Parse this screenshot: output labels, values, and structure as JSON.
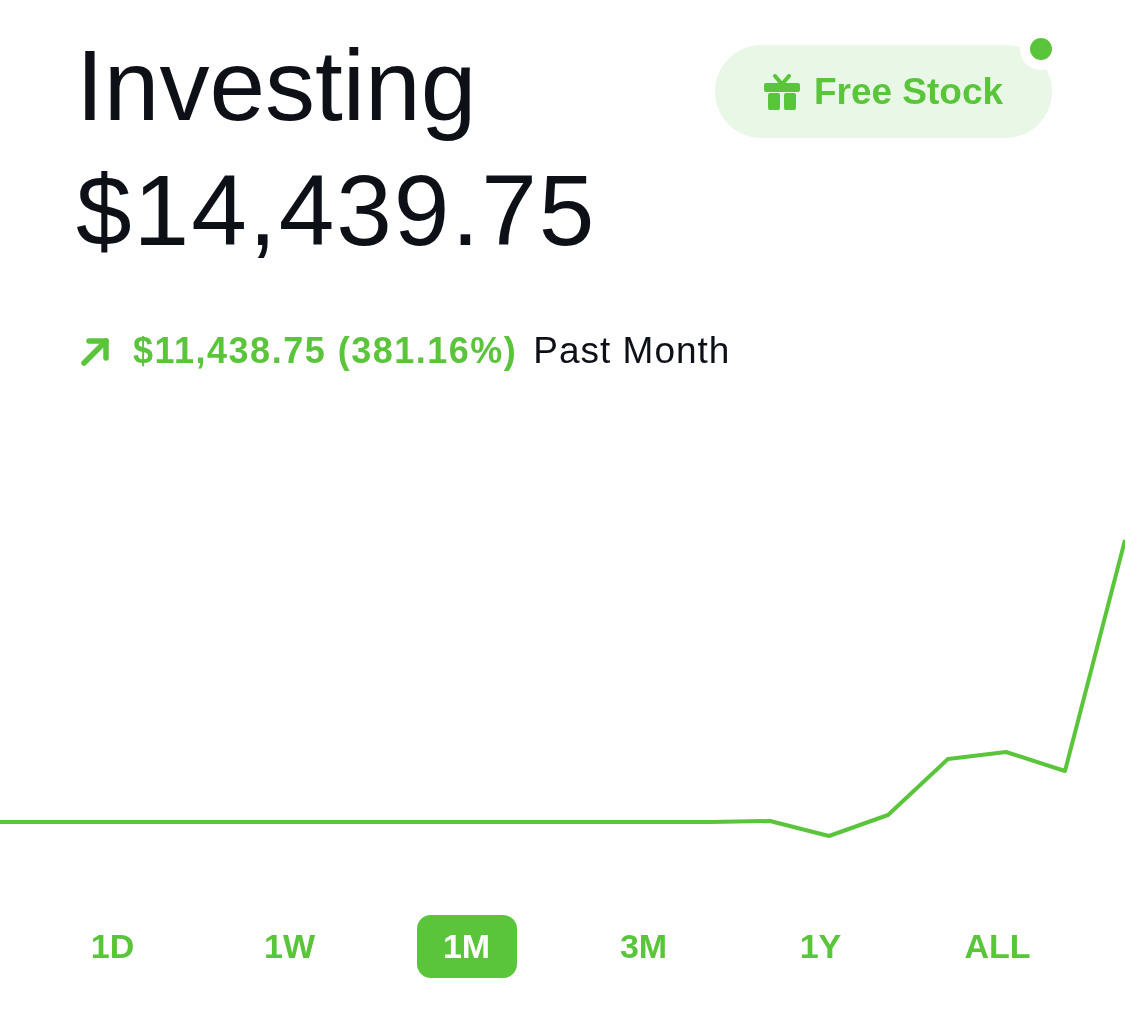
{
  "header": {
    "title": "Investing",
    "balance": "$14,439.75"
  },
  "free_stock_button": {
    "label": "Free Stock",
    "notification_dot": true
  },
  "change": {
    "amount": "$11,438.75 (381.16%)",
    "period": "Past Month"
  },
  "periods": [
    {
      "label": "1D",
      "selected": false
    },
    {
      "label": "1W",
      "selected": false
    },
    {
      "label": "1M",
      "selected": true
    },
    {
      "label": "3M",
      "selected": false
    },
    {
      "label": "1Y",
      "selected": false
    },
    {
      "label": "ALL",
      "selected": false
    }
  ]
}
